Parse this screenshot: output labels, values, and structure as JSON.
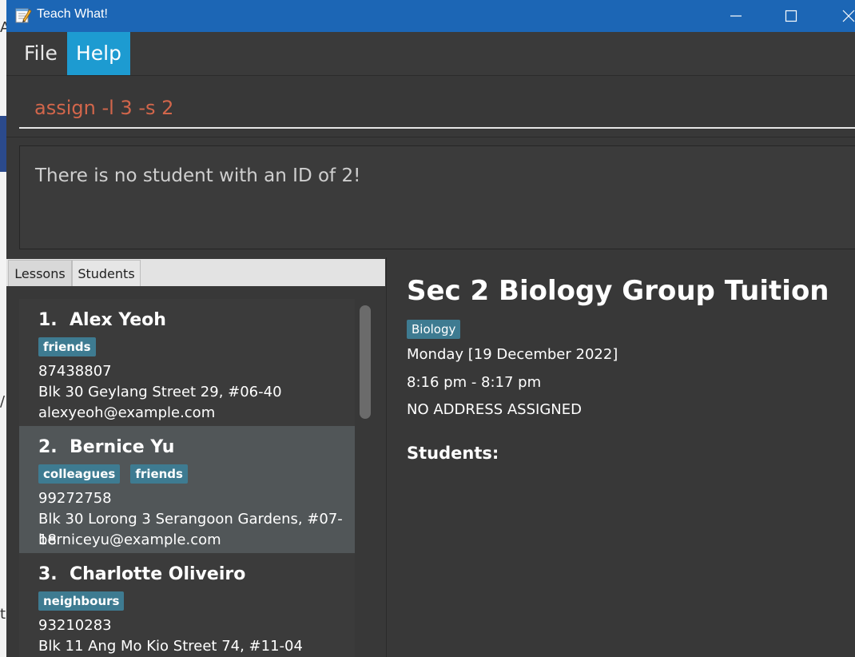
{
  "window": {
    "title": "Teach What!"
  },
  "menu": {
    "file_label": "File",
    "help_label": "Help"
  },
  "command": {
    "value": "assign -l 3 -s 2"
  },
  "result": {
    "message": "There is no student with an ID of 2!"
  },
  "tabs": [
    {
      "label": "Lessons"
    },
    {
      "label": "Students"
    }
  ],
  "students": [
    {
      "index": "1.",
      "name": "Alex Yeoh",
      "tags": [
        "friends"
      ],
      "phone": "87438807",
      "address": "Blk 30 Geylang Street 29, #06-40",
      "email": "alexyeoh@example.com"
    },
    {
      "index": "2.",
      "name": "Bernice Yu",
      "tags": [
        "colleagues",
        "friends"
      ],
      "phone": "99272758",
      "address": "Blk 30 Lorong 3 Serangoon Gardens, #07-18",
      "email": "berniceyu@example.com"
    },
    {
      "index": "3.",
      "name": "Charlotte Oliveiro",
      "tags": [
        "neighbours"
      ],
      "phone": "93210283",
      "address": "Blk 11 Ang Mo Kio Street 74, #11-04",
      "email": ""
    }
  ],
  "lesson": {
    "title": "Sec 2 Biology Group Tuition",
    "subject": "Biology",
    "date": "Monday [19 December 2022]",
    "time": "8:16 pm - 8:17 pm",
    "address": "NO ADDRESS ASSIGNED",
    "students_heading": "Students:"
  },
  "desktop": {
    "glyph_top": "A",
    "glyph_middle": "/",
    "glyph_bottom": "t"
  },
  "colors": {
    "titlebar": "#1c66b5",
    "help_highlight": "#1d9bd1",
    "command_text": "#d2664b",
    "tag_background": "#3e7b91",
    "selected_card": "#515658"
  },
  "icons": {
    "app": "notepad-icon",
    "minimize": "minimize-icon",
    "maximize": "maximize-icon",
    "close": "close-icon"
  }
}
